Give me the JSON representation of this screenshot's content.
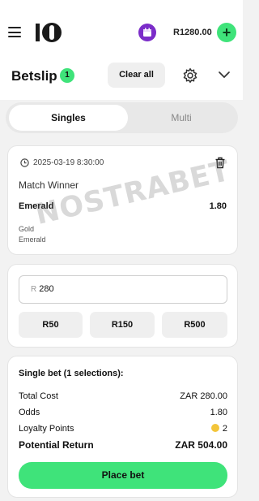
{
  "topbar": {
    "balance": "R1280.00",
    "plus_label": "+"
  },
  "betslip": {
    "title": "Betslip",
    "count": "1",
    "clear_all_label": "Clear all"
  },
  "tabs": [
    {
      "label": "Singles",
      "active": true
    },
    {
      "label": "Multi",
      "active": false
    }
  ],
  "selection": {
    "datetime": "2025-03-19 8:30:00",
    "market": "Match Winner",
    "pick": "Emerald",
    "odds": "1.80",
    "team_1": "Gold",
    "team_2": "Emerald"
  },
  "watermark": "NOSTRABET",
  "stake": {
    "currency": "R",
    "value": "280",
    "quick_amounts": [
      "R50",
      "R150",
      "R500"
    ]
  },
  "summary": {
    "title": "Single bet (1 selections):",
    "total_cost_label": "Total Cost",
    "total_cost_value": "ZAR 280.00",
    "odds_label": "Odds",
    "odds_value": "1.80",
    "loyalty_label": "Loyalty Points",
    "loyalty_value": "2",
    "potential_return_label": "Potential Return",
    "potential_return_value": "ZAR 504.00",
    "place_bet_label": "Place bet"
  },
  "colors": {
    "accent_green": "#3fe37a",
    "calendar_purple": "#7b2cc9",
    "coin_gold": "#f3c53a"
  },
  "icons": [
    "menu-icon",
    "brand-logo",
    "calendar-icon",
    "plus-icon",
    "gear-icon",
    "chevron-down-icon",
    "clock-icon",
    "trash-icon",
    "coin-icon"
  ]
}
